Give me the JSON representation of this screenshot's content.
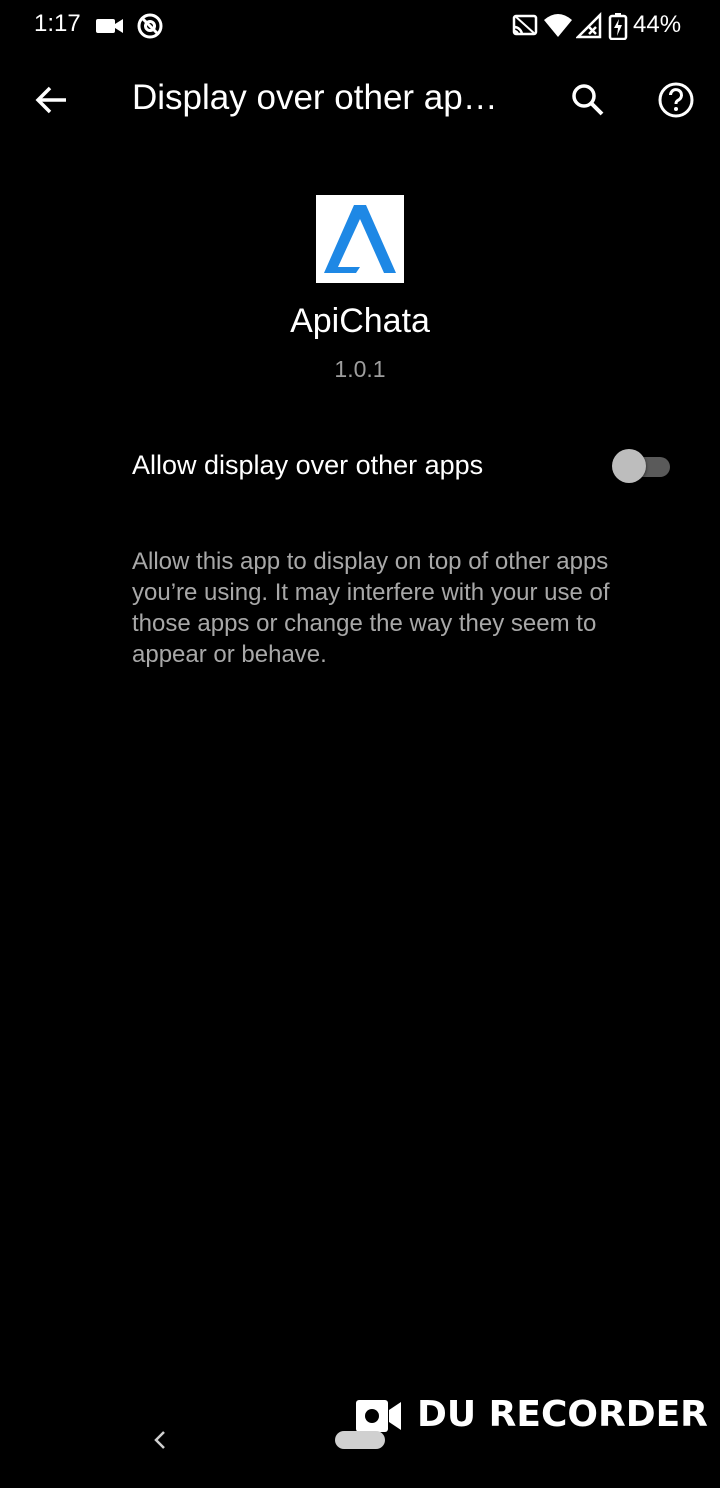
{
  "status_bar": {
    "time": "1:17",
    "battery_percent": "44%",
    "icons": [
      "video-camera-icon",
      "at-sign-icon",
      "cast-icon",
      "wifi-icon",
      "signal-icon",
      "battery-charging-icon"
    ]
  },
  "toolbar": {
    "title": "Display over other ap…",
    "back_icon": "arrow-left-icon",
    "search_icon": "search-icon",
    "help_icon": "help-circle-icon"
  },
  "app": {
    "name": "ApiChata",
    "version": "1.0.1",
    "icon_color": "#1e88e5"
  },
  "setting": {
    "label": "Allow display over other apps",
    "enabled": false,
    "description": "Allow this app to display on top of other apps you’re using. It may interfere with your use of those apps or change the way they seem to appear or behave."
  },
  "watermark": {
    "text": "DU RECORDER"
  },
  "nav_bar": {
    "back_icon": "chevron-left-icon",
    "home_icon": "home-pill-icon"
  }
}
